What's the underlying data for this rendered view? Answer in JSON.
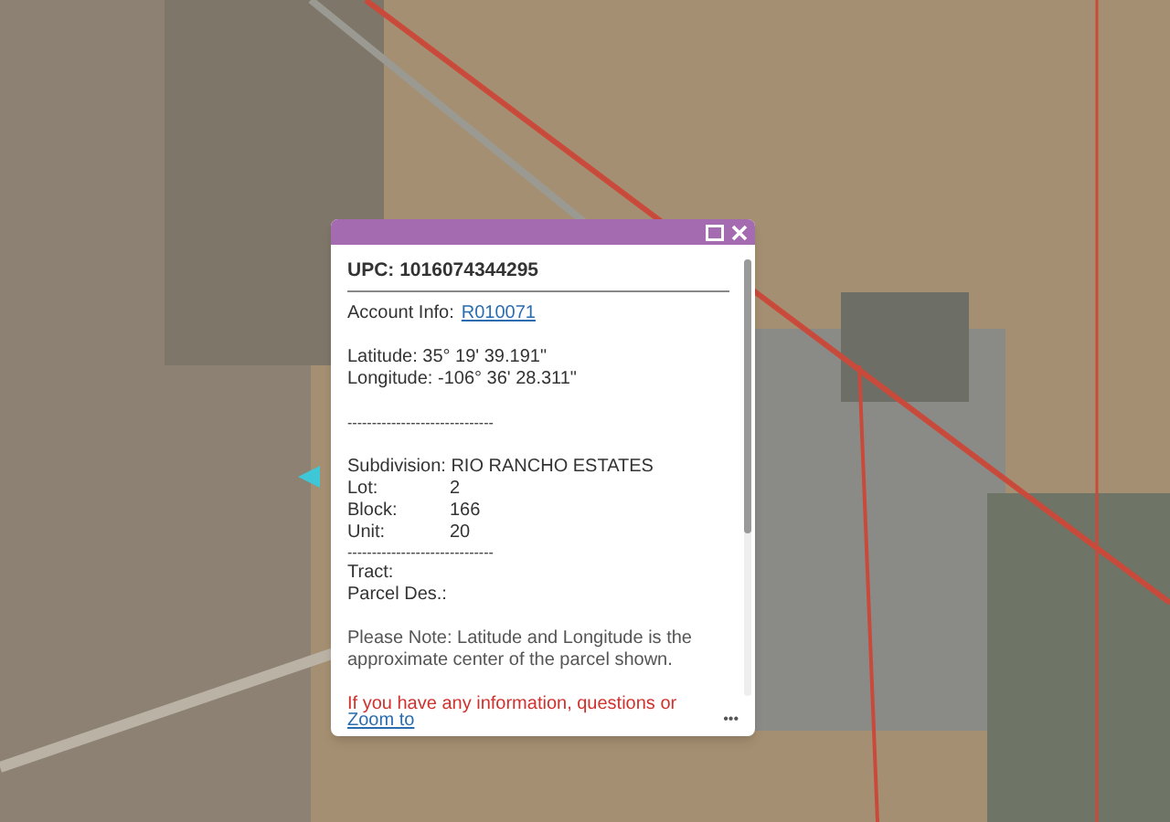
{
  "popup": {
    "upc": "UPC: 1016074344295",
    "account_label": "Account Info:",
    "account_link": "R010071",
    "latitude": "Latitude: 35° 19' 39.191\"",
    "longitude": "Longitude: -106° 36' 28.311\"",
    "separator_1": "------------------------------",
    "subdivision": "Subdivision: RIO RANCHO ESTATES",
    "fields": [
      {
        "label": "Lot:",
        "value": "2"
      },
      {
        "label": "Block:",
        "value": "166"
      },
      {
        "label": "Unit:",
        "value": "20"
      }
    ],
    "separator_2": "------------------------------",
    "tract": "Tract:",
    "parcel_des": "Parcel Des.:",
    "note": "Please Note: Latitude and Longitude is the approximate center of the parcel shown.",
    "warning": "If you have any information, questions or",
    "zoom_link": "Zoom to",
    "more": "•••"
  }
}
